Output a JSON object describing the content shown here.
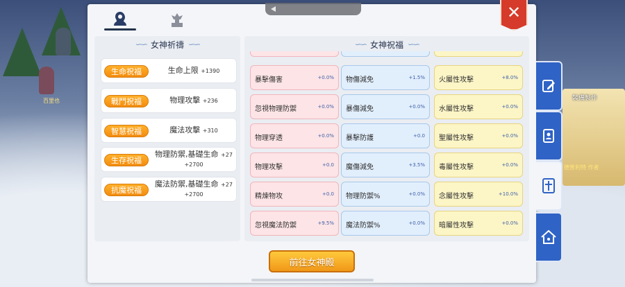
{
  "background": {
    "npc_left_name": "百里也",
    "side_label": "裝備製作",
    "side_sub": "德普利特 作者"
  },
  "tabs": [
    {
      "icon": "goddess-silhouette-icon",
      "active": true
    },
    {
      "icon": "goddess-statue-icon",
      "active": false
    }
  ],
  "left_panel": {
    "title": "女神祈禱",
    "blessings": [
      {
        "tag": "生命祝福",
        "stat": "生命上限",
        "value": "+1390"
      },
      {
        "tag": "戰鬥祝福",
        "stat": "物理攻擊",
        "value": "+236"
      },
      {
        "tag": "智慧祝福",
        "stat": "魔法攻擊",
        "value": "+310"
      },
      {
        "tag": "生存祝福",
        "stat": "物理防禦,基礎生命",
        "value": "+27",
        "value2": "+2700"
      },
      {
        "tag": "抗魔祝福",
        "stat": "魔法防禦,基礎生命",
        "value": "+27",
        "value2": "+2700"
      }
    ]
  },
  "right_panel": {
    "title": "女神祝福",
    "stats": [
      [
        {
          "name": "暴擊傷害",
          "value": "+0.0%"
        },
        {
          "name": "物傷減免",
          "value": "+1.5%"
        },
        {
          "name": "火屬性攻擊",
          "value": "+8.0%"
        }
      ],
      [
        {
          "name": "忽視物理防禦",
          "value": "+0.0%"
        },
        {
          "name": "暴傷減免",
          "value": "+0.0%"
        },
        {
          "name": "水屬性攻擊",
          "value": "+0.0%"
        }
      ],
      [
        {
          "name": "物理穿透",
          "value": "+0.0%"
        },
        {
          "name": "暴擊防護",
          "value": "+0.0"
        },
        {
          "name": "聖屬性攻擊",
          "value": "+0.0%"
        }
      ],
      [
        {
          "name": "物理攻擊",
          "value": "+0.0"
        },
        {
          "name": "魔傷減免",
          "value": "+3.5%"
        },
        {
          "name": "毒屬性攻擊",
          "value": "+0.0%"
        }
      ],
      [
        {
          "name": "精煉物攻",
          "value": "+0.0"
        },
        {
          "name": "物理防禦%",
          "value": "+0.0%"
        },
        {
          "name": "念屬性攻擊",
          "value": "+10.0%"
        }
      ],
      [
        {
          "name": "忽視魔法防禦",
          "value": "+9.5%"
        },
        {
          "name": "魔法防禦%",
          "value": "+0.0%"
        },
        {
          "name": "暗屬性攻擊",
          "value": "+0.0%"
        }
      ]
    ]
  },
  "go_button": "前往女神殿",
  "side_tabs": [
    {
      "icon": "edit-icon",
      "active": false
    },
    {
      "icon": "contacts-book-icon",
      "active": false
    },
    {
      "icon": "holy-cross-icon",
      "active": true
    },
    {
      "icon": "guild-home-icon",
      "active": false
    }
  ],
  "colors": {
    "accent_orange": "#f38c10",
    "close_red": "#d63a2a",
    "side_blue": "#2f63c5"
  }
}
